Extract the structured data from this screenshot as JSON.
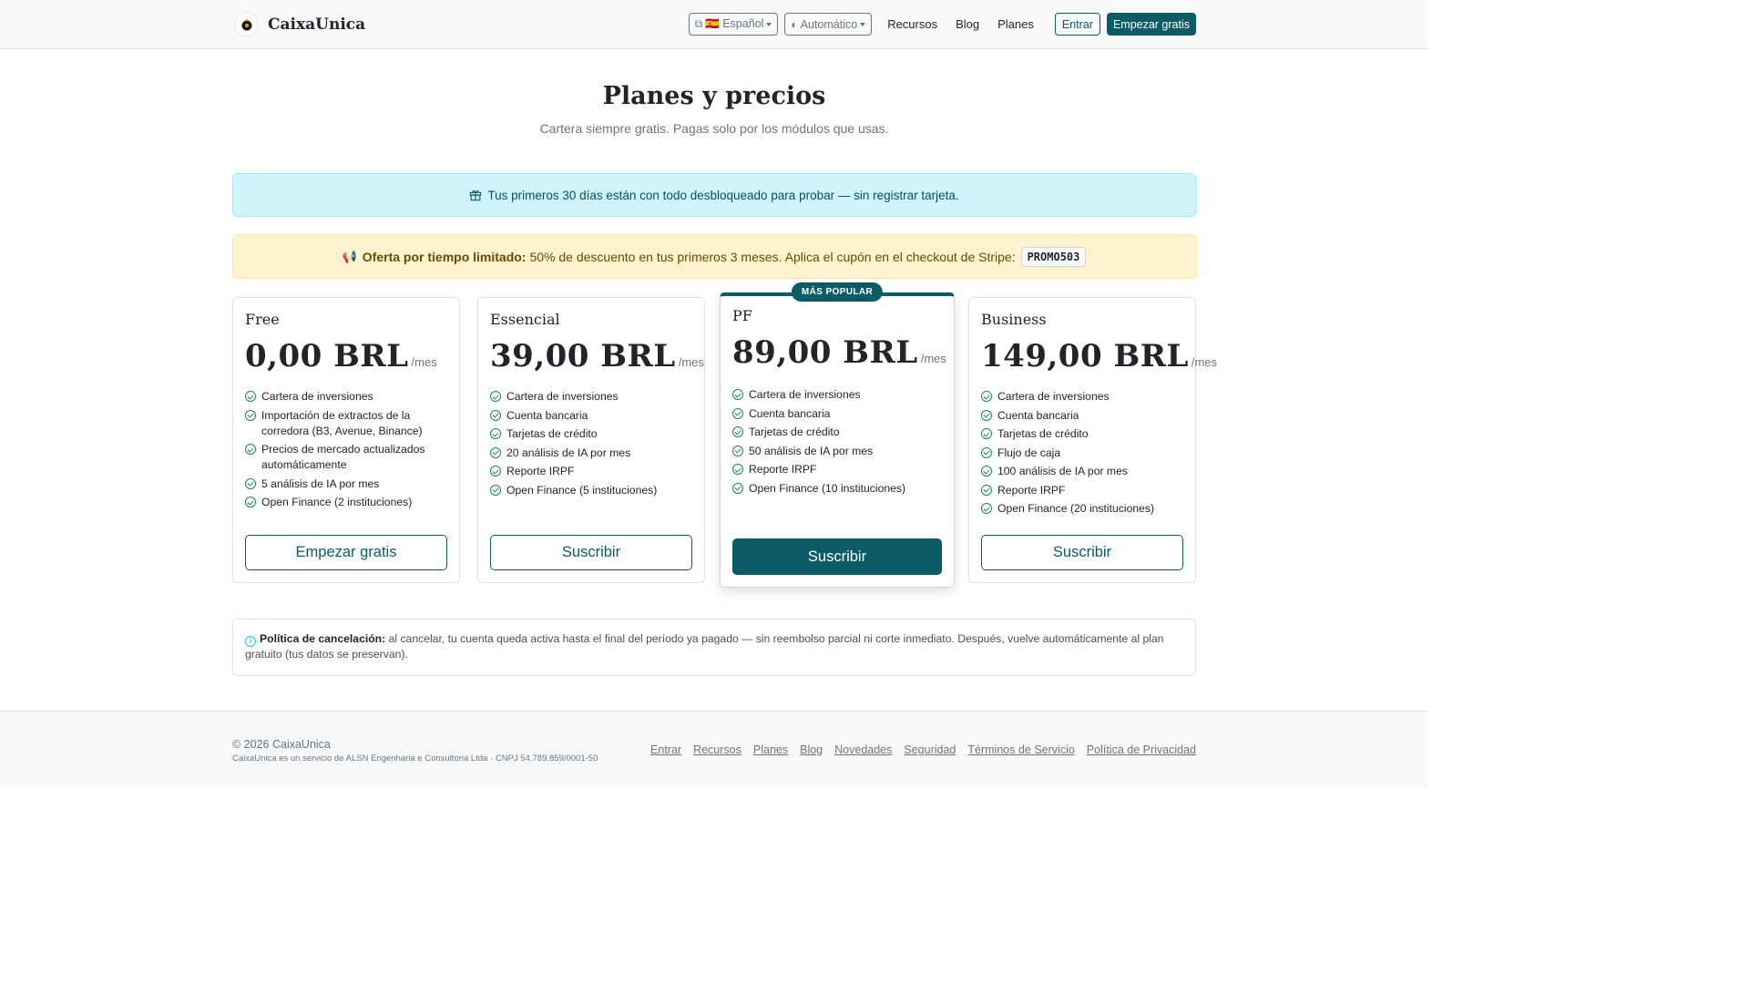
{
  "brand": {
    "name": "CaixaUnica"
  },
  "nav": {
    "language": "🇪🇸 Español",
    "theme": "Automático",
    "links": [
      "Recursos",
      "Blog",
      "Planes"
    ],
    "login": "Entrar",
    "cta": "Empezar gratis"
  },
  "header": {
    "title": "Planes y precios",
    "subtitle": "Cartera siempre gratis. Pagas solo por los módulos que usas."
  },
  "trial_alert": {
    "text": "Tus primeros 30 días están con todo desbloqueado para probar — sin registrar tarjeta."
  },
  "promo_alert": {
    "bold": "Oferta por tiempo limitado:",
    "text": "50% de descuento en tus primeros 3 meses. Aplica el cupón en el checkout de Stripe:",
    "coupon": "PROMO503"
  },
  "plans": [
    {
      "name": "Free",
      "price": "0,00 BRL",
      "period": "/mes",
      "features": [
        "Cartera de inversiones",
        "Importación de extractos de la corredora (B3, Avenue, Binance)",
        "Precios de mercado actualizados automáticamente",
        "5 análisis de IA por mes",
        "Open Finance (2 instituciones)"
      ],
      "button": "Empezar gratis"
    },
    {
      "name": "Essencial",
      "price": "39,00 BRL",
      "period": "/mes",
      "features": [
        "Cartera de inversiones",
        "Cuenta bancaria",
        "Tarjetas de crédito",
        "20 análisis de IA por mes",
        "Reporte IRPF",
        "Open Finance (5 instituciones)"
      ],
      "button": "Suscribir"
    },
    {
      "name": "PF",
      "badge": "MÁS POPULAR",
      "price": "89,00 BRL",
      "period": "/mes",
      "features": [
        "Cartera de inversiones",
        "Cuenta bancaria",
        "Tarjetas de crédito",
        "50 análisis de IA por mes",
        "Reporte IRPF",
        "Open Finance (10 instituciones)"
      ],
      "button": "Suscribir"
    },
    {
      "name": "Business",
      "price": "149,00 BRL",
      "period": "/mes",
      "features": [
        "Cartera de inversiones",
        "Cuenta bancaria",
        "Tarjetas de crédito",
        "Flujo de caja",
        "100 análisis de IA por mes",
        "Reporte IRPF",
        "Open Finance (20 instituciones)"
      ],
      "button": "Suscribir"
    }
  ],
  "policy": {
    "bold": "Política de cancelación:",
    "text": "al cancelar, tu cuenta queda activa hasta el final del período ya pagado — sin reembolso parcial ni corte inmediato. Después, vuelve automáticamente al plan gratuito (tus datos se preservan)."
  },
  "footer": {
    "copyright": "© 2026 CaixaUnica",
    "legal": "CaixaUnica es un servicio de ALSN Engenharia e Consultoria Ltda · CNPJ 54.789.859/0001-50",
    "links": [
      "Entrar",
      "Recursos",
      "Planes",
      "Blog",
      "Novedades",
      "Seguridad",
      "Términos de Servicio",
      "Política de Privacidad"
    ]
  },
  "colors": {
    "primary": "#0b5c66",
    "info_bg": "#cff4fc",
    "warn_bg": "#fff3cd",
    "check": "#198754"
  }
}
